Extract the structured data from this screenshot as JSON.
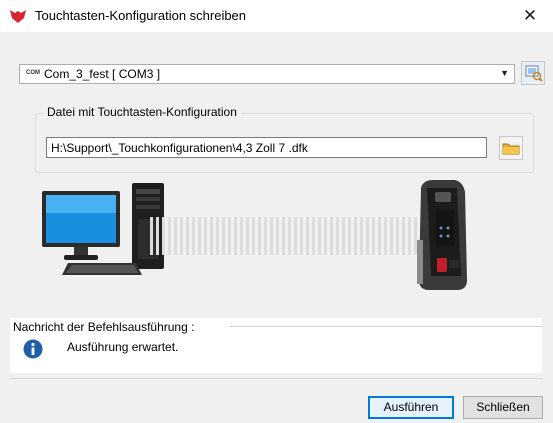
{
  "window": {
    "title": "Touchtasten-Konfiguration schreiben",
    "close_glyph": "✕",
    "app_icon": "red-wing-logo-icon"
  },
  "port": {
    "prefix": "COM",
    "selected": "Com_3_fest [ COM3 ]",
    "arrow": "▼",
    "search_icon": "port-search-icon"
  },
  "file": {
    "group_label": "Datei mit Touchtasten-Konfiguration",
    "path": "H:\\Support\\_Touchkonfigurationen\\4,3 Zoll 7 .dfk",
    "browse_icon": "folder-icon"
  },
  "message": {
    "label": "Nachricht der Befehlsausführung :",
    "text": "Ausführung erwartet.",
    "icon": "info-icon"
  },
  "buttons": {
    "run": "Ausführen",
    "close": "Schließen"
  },
  "colors": {
    "accent": "#0078d7",
    "info": "#1f5fa8",
    "logo": "#d9232e"
  }
}
